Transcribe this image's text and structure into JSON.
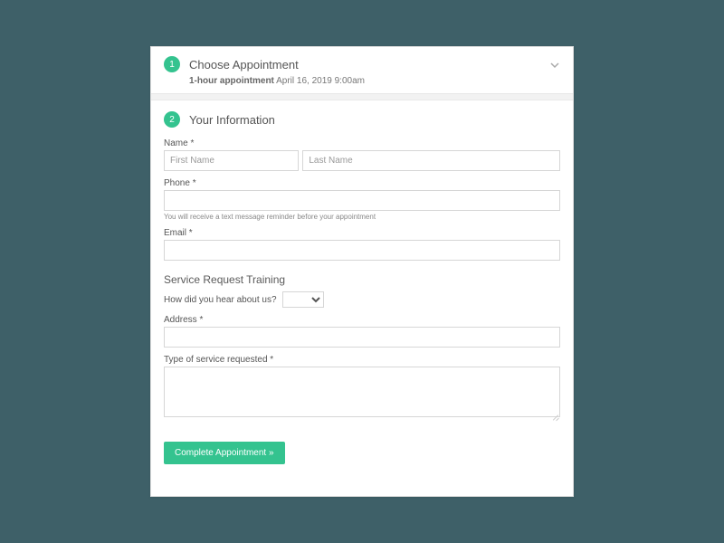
{
  "step1": {
    "number": "1",
    "title": "Choose Appointment",
    "summary_bold": "1-hour appointment",
    "summary_rest": " April 16, 2019 9:00am"
  },
  "step2": {
    "number": "2",
    "title": "Your Information"
  },
  "labels": {
    "name": "Name *",
    "first_placeholder": "First Name",
    "last_placeholder": "Last Name",
    "phone": "Phone *",
    "phone_hint": "You will receive a text message reminder before your appointment",
    "email": "Email *",
    "section2": "Service Request Training",
    "hear": "How did you hear about us?",
    "address": "Address *",
    "service_type": "Type of service requested *"
  },
  "button": {
    "submit": "Complete Appointment »"
  }
}
